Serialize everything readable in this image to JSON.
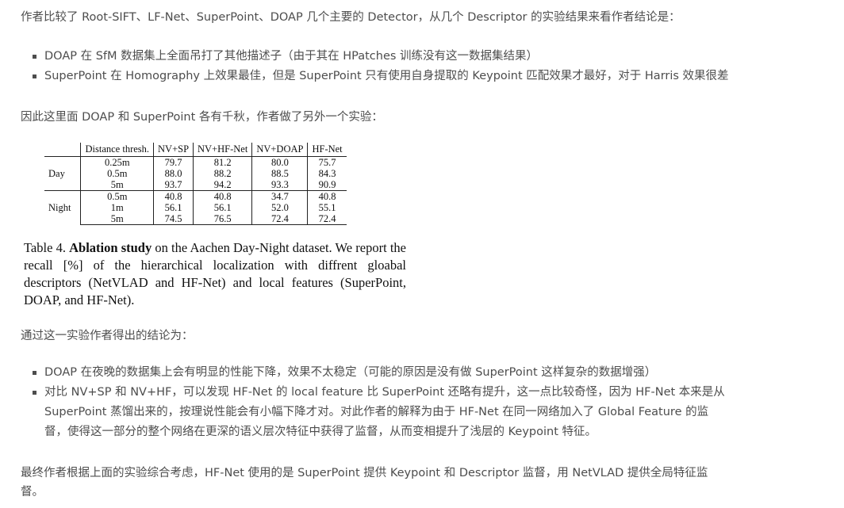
{
  "intro": "作者比较了 Root-SIFT、LF-Net、SuperPoint、DOAP 几个主要的 Detector，从几个 Descriptor 的实验结果来看作者结论是：",
  "list1": [
    "DOAP 在 SfM 数据集上全面吊打了其他描述子（由于其在 HPatches 训练没有这一数据集结果）",
    "SuperPoint 在 Homography 上效果最佳，但是 SuperPoint 只有使用自身提取的 Keypoint 匹配效果才最好，对于 Harris 效果很差"
  ],
  "para2": "因此这里面 DOAP 和 SuperPoint 各有千秋，作者做了另外一个实验：",
  "table": {
    "headers": [
      "Distance thresh.",
      "NV+SP",
      "NV+HF-Net",
      "NV+DOAP",
      "HF-Net"
    ],
    "groups": [
      {
        "label": "Day",
        "rows": [
          [
            "0.25m",
            "79.7",
            "81.2",
            "80.0",
            "75.7"
          ],
          [
            "0.5m",
            "88.0",
            "88.2",
            "88.5",
            "84.3"
          ],
          [
            "5m",
            "93.7",
            "94.2",
            "93.3",
            "90.9"
          ]
        ]
      },
      {
        "label": "Night",
        "rows": [
          [
            "0.5m",
            "40.8",
            "40.8",
            "34.7",
            "40.8"
          ],
          [
            "1m",
            "56.1",
            "56.1",
            "52.0",
            "55.1"
          ],
          [
            "5m",
            "74.5",
            "76.5",
            "72.4",
            "72.4"
          ]
        ]
      }
    ],
    "caption_prefix": "Table 4. ",
    "caption_bold": "Ablation study",
    "caption_rest": " on the Aachen Day-Night dataset. We report the recall [%] of the hierarchical localization with diffrent gloabal descriptors (NetVLAD and HF-Net) and local features (SuperPoint, DOAP, and HF-Net)."
  },
  "para3": "通过这一实验作者得出的结论为：",
  "list2": [
    "DOAP 在夜晚的数据集上会有明显的性能下降，效果不太稳定（可能的原因是没有做 SuperPoint 这样复杂的数据增强）"
  ],
  "list2_item2_lines": [
    "对比 NV+SP 和 NV+HF，可以发现 HF-Net 的 local feature 比 SuperPoint 还略有提升，这一点比较奇怪，因为 HF-Net 本来是从",
    "SuperPoint 蒸馏出来的，按理说性能会有小幅下降才对。对此作者的解释为由于 HF-Net 在同一网络加入了 Global Feature 的监",
    "督，使得这一部分的整个网络在更深的语义层次特征中获得了监督，从而变相提升了浅层的 Keypoint 特征。"
  ],
  "final_lines": [
    "最终作者根据上面的实验综合考虑，HF-Net 使用的是 SuperPoint 提供 Keypoint 和 Descriptor 监督，用 NetVLAD 提供全局特征监",
    "督。"
  ]
}
